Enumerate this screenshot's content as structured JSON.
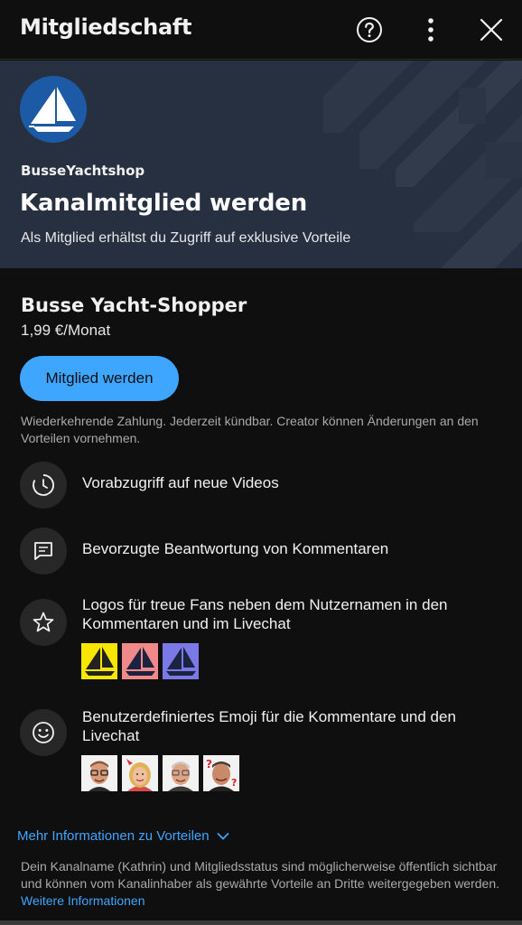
{
  "header": {
    "title": "Mitgliedschaft",
    "help_icon": "help-circle-icon",
    "more_icon": "more-vert-icon",
    "close_icon": "close-icon"
  },
  "hero": {
    "channel_name": "BusseYachtshop",
    "headline": "Kanalmitglied werden",
    "subtitle": "Als Mitglied erhältst du Zugriff auf exklusive Vorteile",
    "avatar_icon": "sailboat-logo",
    "colors": {
      "background": "#263040",
      "avatar": "#1d5aa6"
    }
  },
  "tier": {
    "name": "Busse Yacht-Shopper",
    "price": "1,99 €/Monat",
    "join_label": "Mitglied werden",
    "note": "Wiederkehrende Zahlung. Jederzeit kündbar. Creator können Änderungen an den Vorteilen vornehmen."
  },
  "perks": [
    {
      "icon": "early-access-clock-icon",
      "text": "Vorabzugriff auf neue Videos"
    },
    {
      "icon": "comment-icon",
      "text": "Bevorzugte Beantwortung von Kommentaren"
    },
    {
      "icon": "star-icon",
      "text": "Logos für treue Fans neben dem Nutzernamen in den Kommentaren und im Livechat"
    },
    {
      "icon": "smiley-icon",
      "text": "Benutzerdefiniertes Emoji für die Kommentare und den Livechat"
    }
  ],
  "badges": [
    {
      "name": "badge-yellow-sailboat",
      "color": "#f7e600"
    },
    {
      "name": "badge-pink-sailboat",
      "color": "#f08a8a"
    },
    {
      "name": "badge-purple-sailboat",
      "color": "#7b78e8"
    }
  ],
  "emojis": [
    "emoji-man-glasses",
    "emoji-woman-blonde",
    "emoji-man-grey",
    "emoji-man-question"
  ],
  "more_info": {
    "label": "Mehr Informationen zu Vorteilen",
    "icon": "chevron-down-icon"
  },
  "footer": {
    "text": "Dein Kanalname (Kathrin) und Mitgliedsstatus sind möglicherweise öffentlich sichtbar und können vom Kanalinhaber als gewährte Vorteile an Dritte weitergegeben werden.",
    "link": "Weitere Informationen"
  },
  "colors": {
    "accent": "#3ea6ff",
    "page_bg": "#0f0f0f",
    "icon_circle": "#272727"
  }
}
